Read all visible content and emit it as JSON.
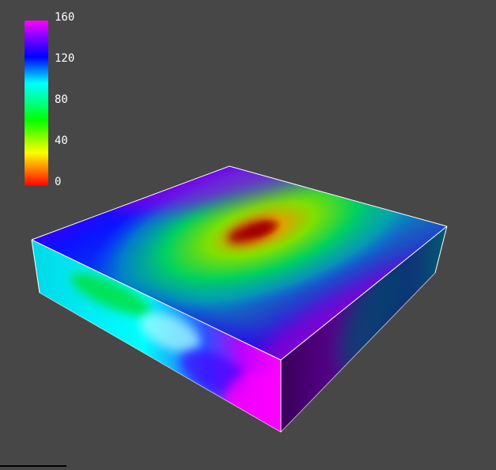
{
  "colorbar": {
    "ticks": [
      "160",
      "120",
      "80",
      "40",
      "0"
    ],
    "colors": [
      "#ff0000",
      "#ffff00",
      "#00ff00",
      "#00ffff",
      "#0000ff",
      "#ff00ff"
    ]
  }
}
